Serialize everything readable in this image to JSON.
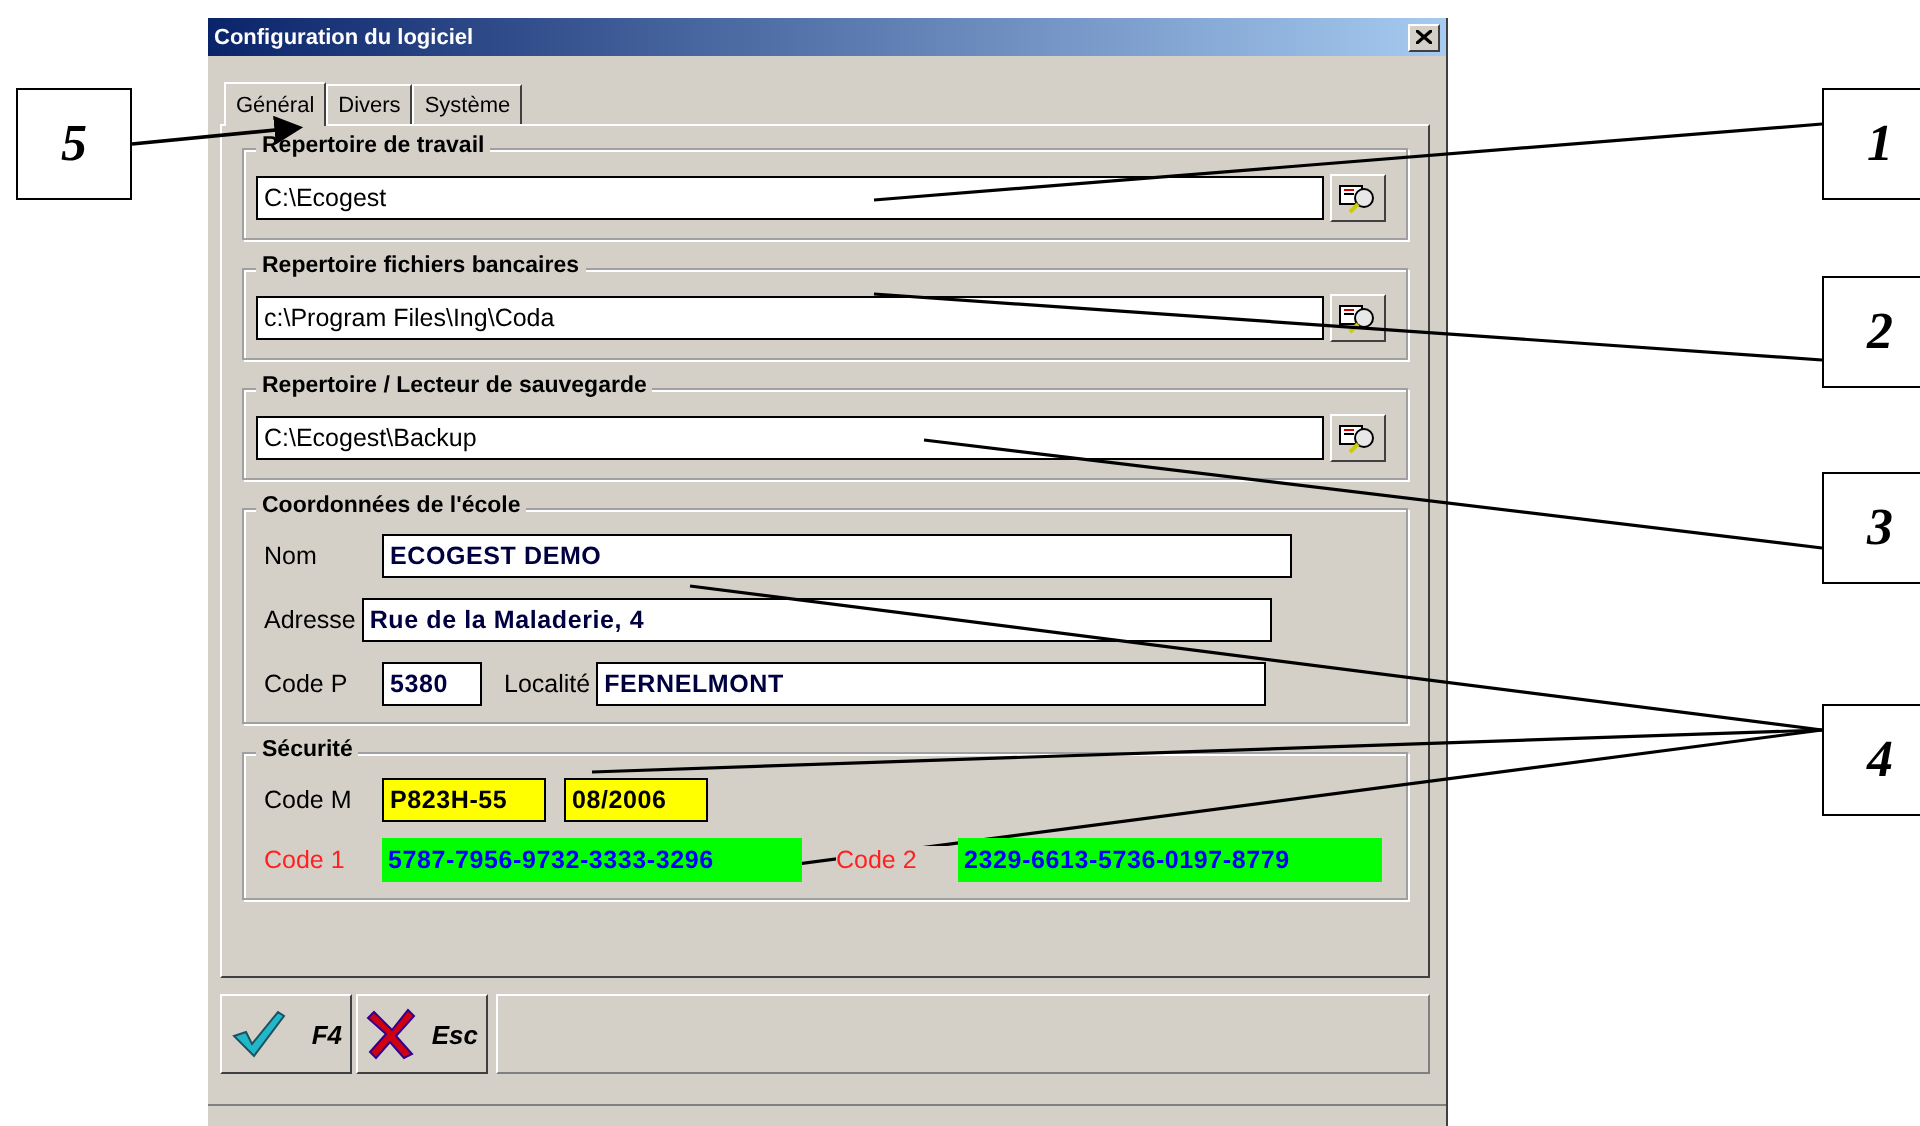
{
  "window": {
    "title": "Configuration du logiciel"
  },
  "tabs": [
    {
      "label": "Général",
      "selected": true
    },
    {
      "label": "Divers",
      "selected": false
    },
    {
      "label": "Système",
      "selected": false
    }
  ],
  "path_groups": [
    {
      "title": "Repertoire de travail",
      "value": "C:\\Ecogest"
    },
    {
      "title": "Repertoire fichiers bancaires",
      "value": "c:\\Program Files\\Ing\\Coda"
    },
    {
      "title": "Repertoire / Lecteur de sauvegarde",
      "value": "C:\\Ecogest\\Backup"
    }
  ],
  "school": {
    "title": "Coordonnées de l'école",
    "name_label": "Nom",
    "name": "ECOGEST DEMO",
    "address_label": "Adresse",
    "address": "Rue de la Maladerie, 4",
    "postcode_label": "Code P",
    "postcode": "5380",
    "city_label": "Localité",
    "city": "FERNELMONT"
  },
  "security": {
    "title": "Sécurité",
    "code_m_label": "Code M",
    "code_m": "P823H-55",
    "code_m_date": "08/2006",
    "code1_label": "Code 1",
    "code1": "5787-7956-9732-3333-3296",
    "code2_label": "Code 2",
    "code2": "2329-6613-5736-0197-8779"
  },
  "buttons": [
    {
      "kind": "confirm",
      "label": "F4"
    },
    {
      "kind": "cancel",
      "label": "Esc"
    }
  ],
  "callouts": [
    {
      "number": "5"
    },
    {
      "number": "1"
    },
    {
      "number": "2"
    },
    {
      "number": "3"
    },
    {
      "number": "4"
    }
  ]
}
